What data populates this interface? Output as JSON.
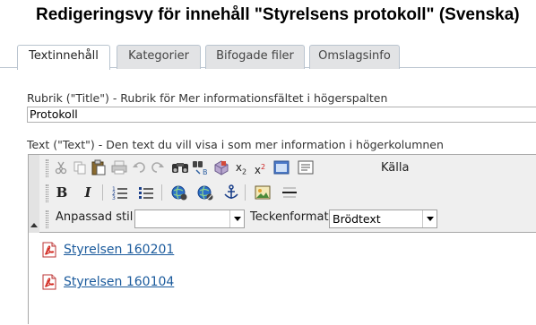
{
  "page": {
    "title": "Redigeringsvy för innehåll \"Styrelsens protokoll\" (Svenska)"
  },
  "tabs": [
    {
      "label": "Textinnehåll",
      "active": true
    },
    {
      "label": "Kategorier",
      "active": false
    },
    {
      "label": "Bifogade filer",
      "active": false
    },
    {
      "label": "Omslagsinfo",
      "active": false
    }
  ],
  "rubrik_field": {
    "label": "Rubrik (\"Title\") - Rubrik för Mer informationsfältet i högerspalten",
    "value": "Protokoll"
  },
  "text_field": {
    "label": "Text (\"Text\") - Den text du vill visa i som mer information i högerkolumnen"
  },
  "toolbar": {
    "source_label": "Källa",
    "bold_glyph": "B",
    "italic_glyph": "I",
    "style_label": "Anpassad stil",
    "style_value": "",
    "format_label": "Teckenformat",
    "format_value": "Brödtext"
  },
  "content": {
    "files": [
      {
        "name": "Styrelsen 160201",
        "icon": "pdf-icon"
      },
      {
        "name": "Styrelsen 160104",
        "icon": "pdf-icon"
      }
    ]
  },
  "colors": {
    "link": "#1a5a9c",
    "tab_inactive_bg": "#e2e3e5",
    "toolbar_bg": "#efefef",
    "pdf_red": "#d2261d"
  }
}
